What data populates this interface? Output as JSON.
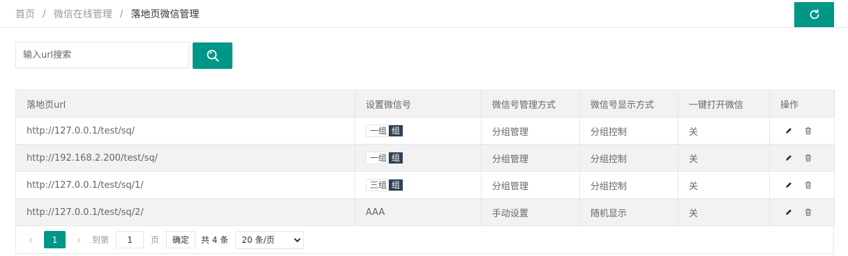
{
  "breadcrumb": {
    "items": [
      "首页",
      "微信在线管理",
      "落地页微信管理"
    ],
    "separator": "/"
  },
  "toolbar": {
    "refresh_icon": "refresh-icon"
  },
  "search": {
    "placeholder": "输入url搜索",
    "value": "",
    "button_icon": "search-icon"
  },
  "table": {
    "headers": [
      "落地页url",
      "设置微信号",
      "微信号管理方式",
      "微信号显示方式",
      "一键打开微信",
      "操作"
    ],
    "rows": [
      {
        "url": "http://127.0.0.1/test/sq/",
        "wx_name": "一组",
        "wx_tag": "组",
        "manage": "分组管理",
        "display": "分组控制",
        "open": "关"
      },
      {
        "url": "http://192.168.2.200/test/sq/",
        "wx_name": "一组",
        "wx_tag": "组",
        "manage": "分组管理",
        "display": "分组控制",
        "open": "关"
      },
      {
        "url": "http://127.0.0.1/test/sq/1/",
        "wx_name": "三组",
        "wx_tag": "组",
        "manage": "分组管理",
        "display": "分组控制",
        "open": "关"
      },
      {
        "url": "http://127.0.0.1/test/sq/2/",
        "wx_name": "AAA",
        "wx_tag": "",
        "manage": "手动设置",
        "display": "随机显示",
        "open": "关"
      }
    ]
  },
  "pagination": {
    "current_page": "1",
    "goto_label": "到第",
    "goto_value": "1",
    "page_label": "页",
    "confirm_label": "确定",
    "total_text": "共 4 条",
    "limit_selected": "20 条/页"
  },
  "colors": {
    "primary": "#009688",
    "tag_dark": "#2f4056"
  }
}
